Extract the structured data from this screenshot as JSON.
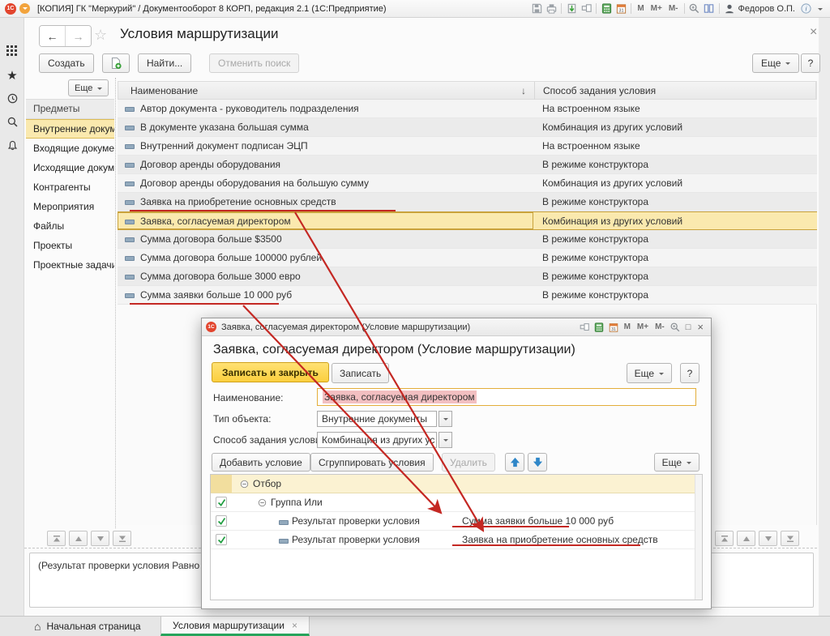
{
  "os_bar": {
    "logo": "1С",
    "title": "[КОПИЯ] ГК \"Меркурий\" / Документооборот 8 КОРП, редакция 2.1  (1С:Предприятие)",
    "m_buttons": [
      "M",
      "M+",
      "M-"
    ],
    "user": "Федоров О.П."
  },
  "window": {
    "back": "←",
    "forward": "→",
    "star": "☆",
    "title": "Условия маршрутизации",
    "close": "×"
  },
  "toolbar": {
    "create": "Создать",
    "find": "Найти...",
    "cancel_search": "Отменить поиск",
    "more": "Еще",
    "help": "?"
  },
  "sidebar": {
    "more": "Еще",
    "header": "Предметы",
    "items": [
      "Внутренние документы",
      "Входящие документы",
      "Исходящие документы",
      "Контрагенты",
      "Мероприятия",
      "Файлы",
      "Проекты",
      "Проектные задачи"
    ]
  },
  "table": {
    "col_name": "Наименование",
    "sort": "↓",
    "col_method": "Способ задания условия",
    "rows": [
      {
        "name": "Автор документа - руководитель подразделения",
        "method": "На встроенном языке"
      },
      {
        "name": "В документе указана большая сумма",
        "method": "Комбинация из других условий"
      },
      {
        "name": "Внутренний документ подписан ЭЦП",
        "method": "На встроенном языке"
      },
      {
        "name": "Договор аренды оборудования",
        "method": "В режиме конструктора"
      },
      {
        "name": "Договор аренды оборудования на большую сумму",
        "method": "Комбинация из других условий"
      },
      {
        "name": "Заявка на приобретение основных средств",
        "method": "В режиме конструктора"
      },
      {
        "name": "Заявка, согласуемая директором",
        "method": "Комбинация из других условий"
      },
      {
        "name": "Сумма договора больше $3500",
        "method": "В режиме конструктора"
      },
      {
        "name": "Сумма договора больше 100000 рублей",
        "method": "В режиме конструктора"
      },
      {
        "name": "Сумма договора больше 3000 евро",
        "method": "В режиме конструктора"
      },
      {
        "name": "Сумма заявки больше 10 000 руб",
        "method": "В режиме конструктора"
      }
    ]
  },
  "status_text": "(Результат проверки условия Равно \"Сумм",
  "dialog": {
    "logo": "1С",
    "titlebar": "Заявка, согласуемая директором (Условие маршрутизации)",
    "m_buttons": [
      "M",
      "M+",
      "M-"
    ],
    "maximize": "□",
    "close": "×",
    "heading": "Заявка, согласуемая директором (Условие маршрутизации)",
    "save_close": "Записать и закрыть",
    "save": "Записать",
    "more": "Еще",
    "help": "?",
    "fields": {
      "name_label": "Наименование:",
      "name_value": "Заявка, согласуемая директором",
      "type_label": "Тип объекта:",
      "type_value": "Внутренние документы",
      "method_label": "Способ задания условия:",
      "method_value": "Комбинация из других ус"
    },
    "commands": {
      "add": "Добавить условие",
      "group": "Сгруппировать условия",
      "delete": "Удалить",
      "more": "Еще"
    },
    "tree": {
      "root": "Отбор",
      "group": "Группа Или",
      "rows": [
        {
          "label": "Результат проверки условия",
          "value": "Сумма заявки больше 10 000 руб"
        },
        {
          "label": "Результат проверки условия",
          "value": "Заявка на приобретение основных средств"
        }
      ]
    }
  },
  "tabs": {
    "home": "Начальная страница",
    "home_icon": "⌂",
    "current": "Условия маршрутизации",
    "close": "×"
  },
  "icons": {
    "calendar_label": "31",
    "info": "i"
  },
  "colors": {
    "selection": "#FAE9AE",
    "annotation_red": "#C42823",
    "tab_active_green": "#27A45C",
    "primary_button_yellow": "#FBCF3E"
  }
}
